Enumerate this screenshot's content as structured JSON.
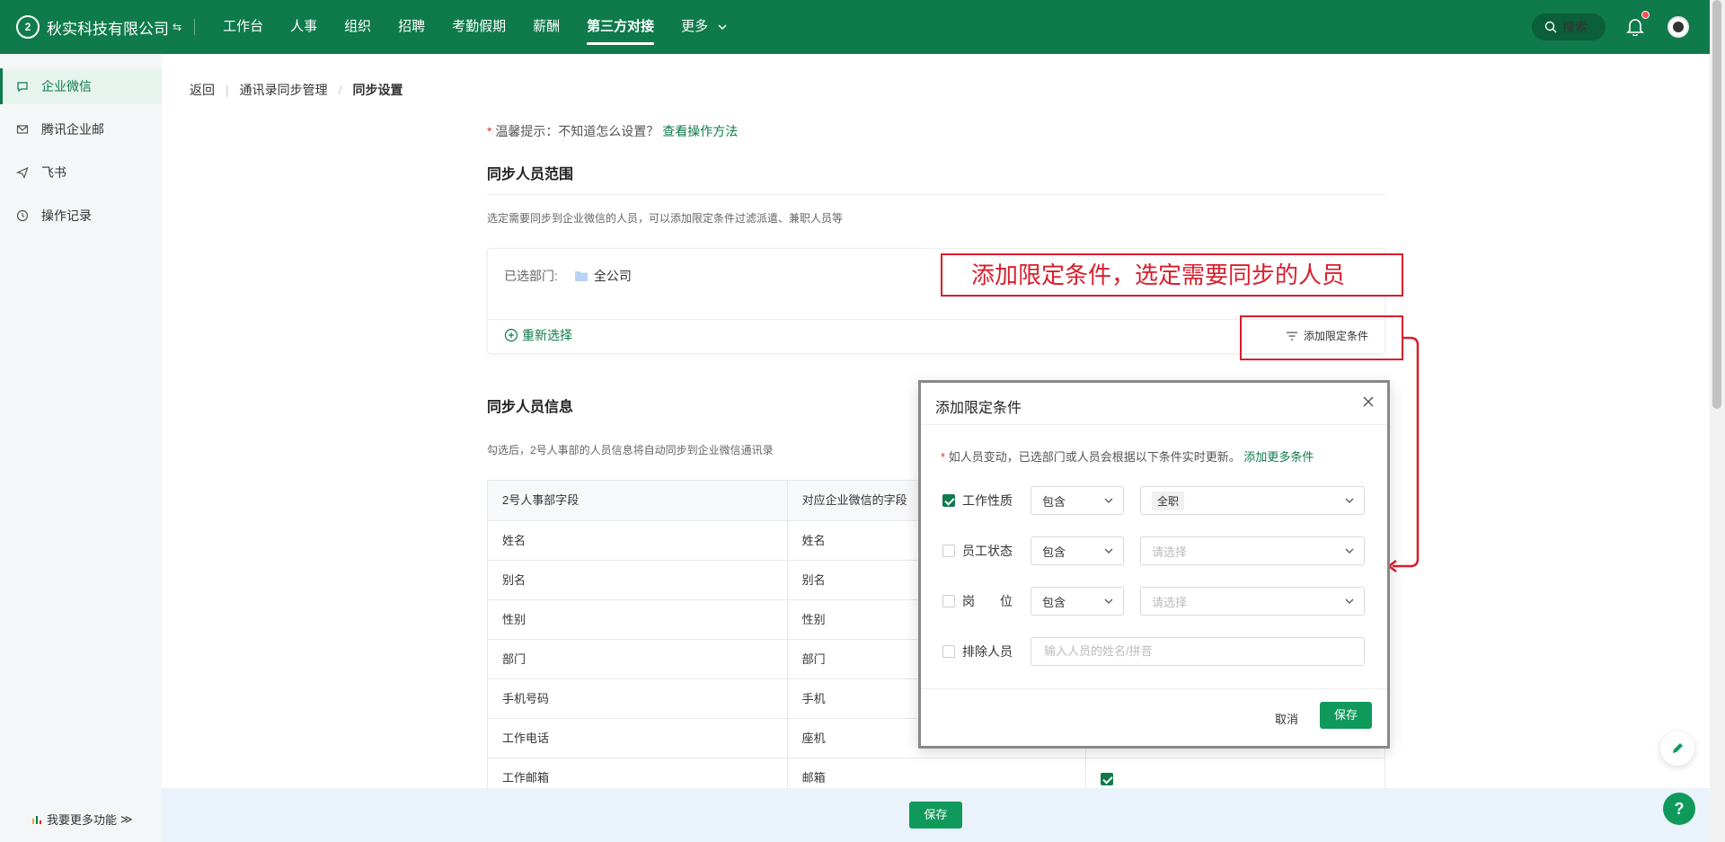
{
  "header": {
    "logo_text": "2",
    "company": "秋实科技有限公司",
    "nav": [
      "工作台",
      "人事",
      "组织",
      "招聘",
      "考勤假期",
      "薪酬",
      "第三方对接",
      "更多"
    ],
    "active_nav": "第三方对接",
    "search_label": "搜索"
  },
  "sidebar": {
    "items": [
      "企业微信",
      "腾讯企业邮",
      "飞书",
      "操作记录"
    ],
    "bottom_label": "我要更多功能"
  },
  "breadcrumb": [
    "返回",
    "通讯录同步管理",
    "同步设置"
  ],
  "tip": {
    "star": "*",
    "text": "温馨提示：不知道怎么设置？",
    "link": "查看操作方法"
  },
  "scope": {
    "title": "同步人员范围",
    "desc": "选定需要同步到企业微信的人员，可以添加限定条件过滤派遣、兼职人员等",
    "selected_label": "已选部门:",
    "selected_value": "全公司",
    "reselect": "重新选择",
    "add_condition": "添加限定条件"
  },
  "info": {
    "title": "同步人员信息",
    "desc": "勾选后，2号人事部的人员信息将自动同步到企业微信通讯录",
    "headers": [
      "2号人事部字段",
      "对应企业微信的字段",
      ""
    ],
    "rows": [
      [
        "姓名",
        "姓名"
      ],
      [
        "别名",
        "别名"
      ],
      [
        "性别",
        "性别"
      ],
      [
        "部门",
        "部门"
      ],
      [
        "手机号码",
        "手机"
      ],
      [
        "工作电话",
        "座机"
      ],
      [
        "工作邮箱",
        "邮箱"
      ]
    ]
  },
  "footer": {
    "save": "保存"
  },
  "annotation": {
    "text": "添加限定条件，选定需要同步的人员"
  },
  "modal": {
    "title": "添加限定条件",
    "notice_star": "*",
    "notice": "如人员变动，已选部门或人员会根据以下条件实时更新。",
    "notice_link": "添加更多条件",
    "conditions": [
      {
        "label": "工作性质",
        "checked": true,
        "operator": "包含",
        "value": "全职"
      },
      {
        "label": "员工状态",
        "checked": false,
        "operator": "包含",
        "placeholder": "请选择"
      },
      {
        "label": "岗　　位",
        "checked": false,
        "operator": "包含",
        "placeholder": "请选择"
      }
    ],
    "exclude_label": "排除人员",
    "exclude_placeholder": "输入人员的姓名/拼音",
    "cancel": "取消",
    "save": "保存"
  },
  "colors": {
    "brand": "#0f7a4c",
    "accent_button": "#0f9a5b",
    "annotation_red": "#d81e2c"
  }
}
